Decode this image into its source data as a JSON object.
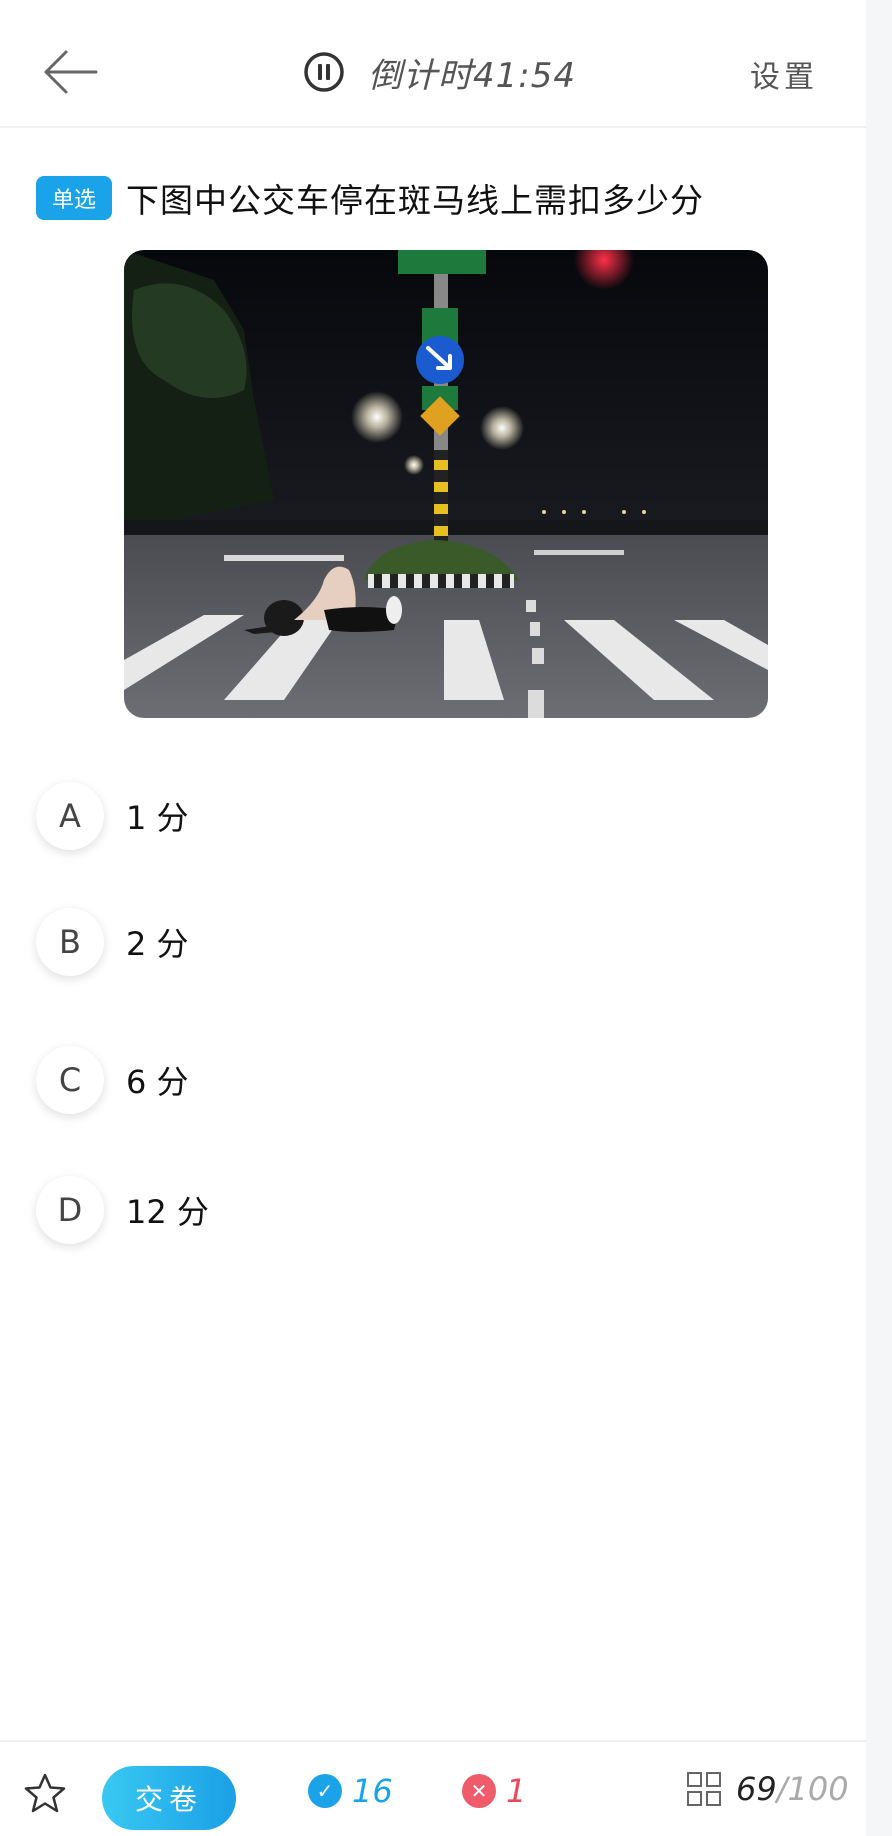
{
  "header": {
    "timer_text": "倒计时41:54",
    "settings_label": "设置"
  },
  "question": {
    "type_label": "单选",
    "text": "下图中公交车停在斑马线上需扣多少分"
  },
  "options": [
    {
      "letter": "A",
      "text": "1 分"
    },
    {
      "letter": "B",
      "text": "2 分"
    },
    {
      "letter": "C",
      "text": "6 分"
    },
    {
      "letter": "D",
      "text": "12 分"
    }
  ],
  "bottom_bar": {
    "submit_label": "交卷",
    "correct_count": "16",
    "wrong_count": "1",
    "progress_current": "69",
    "progress_separator": "/",
    "progress_total": "100"
  },
  "colors": {
    "accent": "#1aa3e8",
    "wrong": "#ef5b6b"
  }
}
